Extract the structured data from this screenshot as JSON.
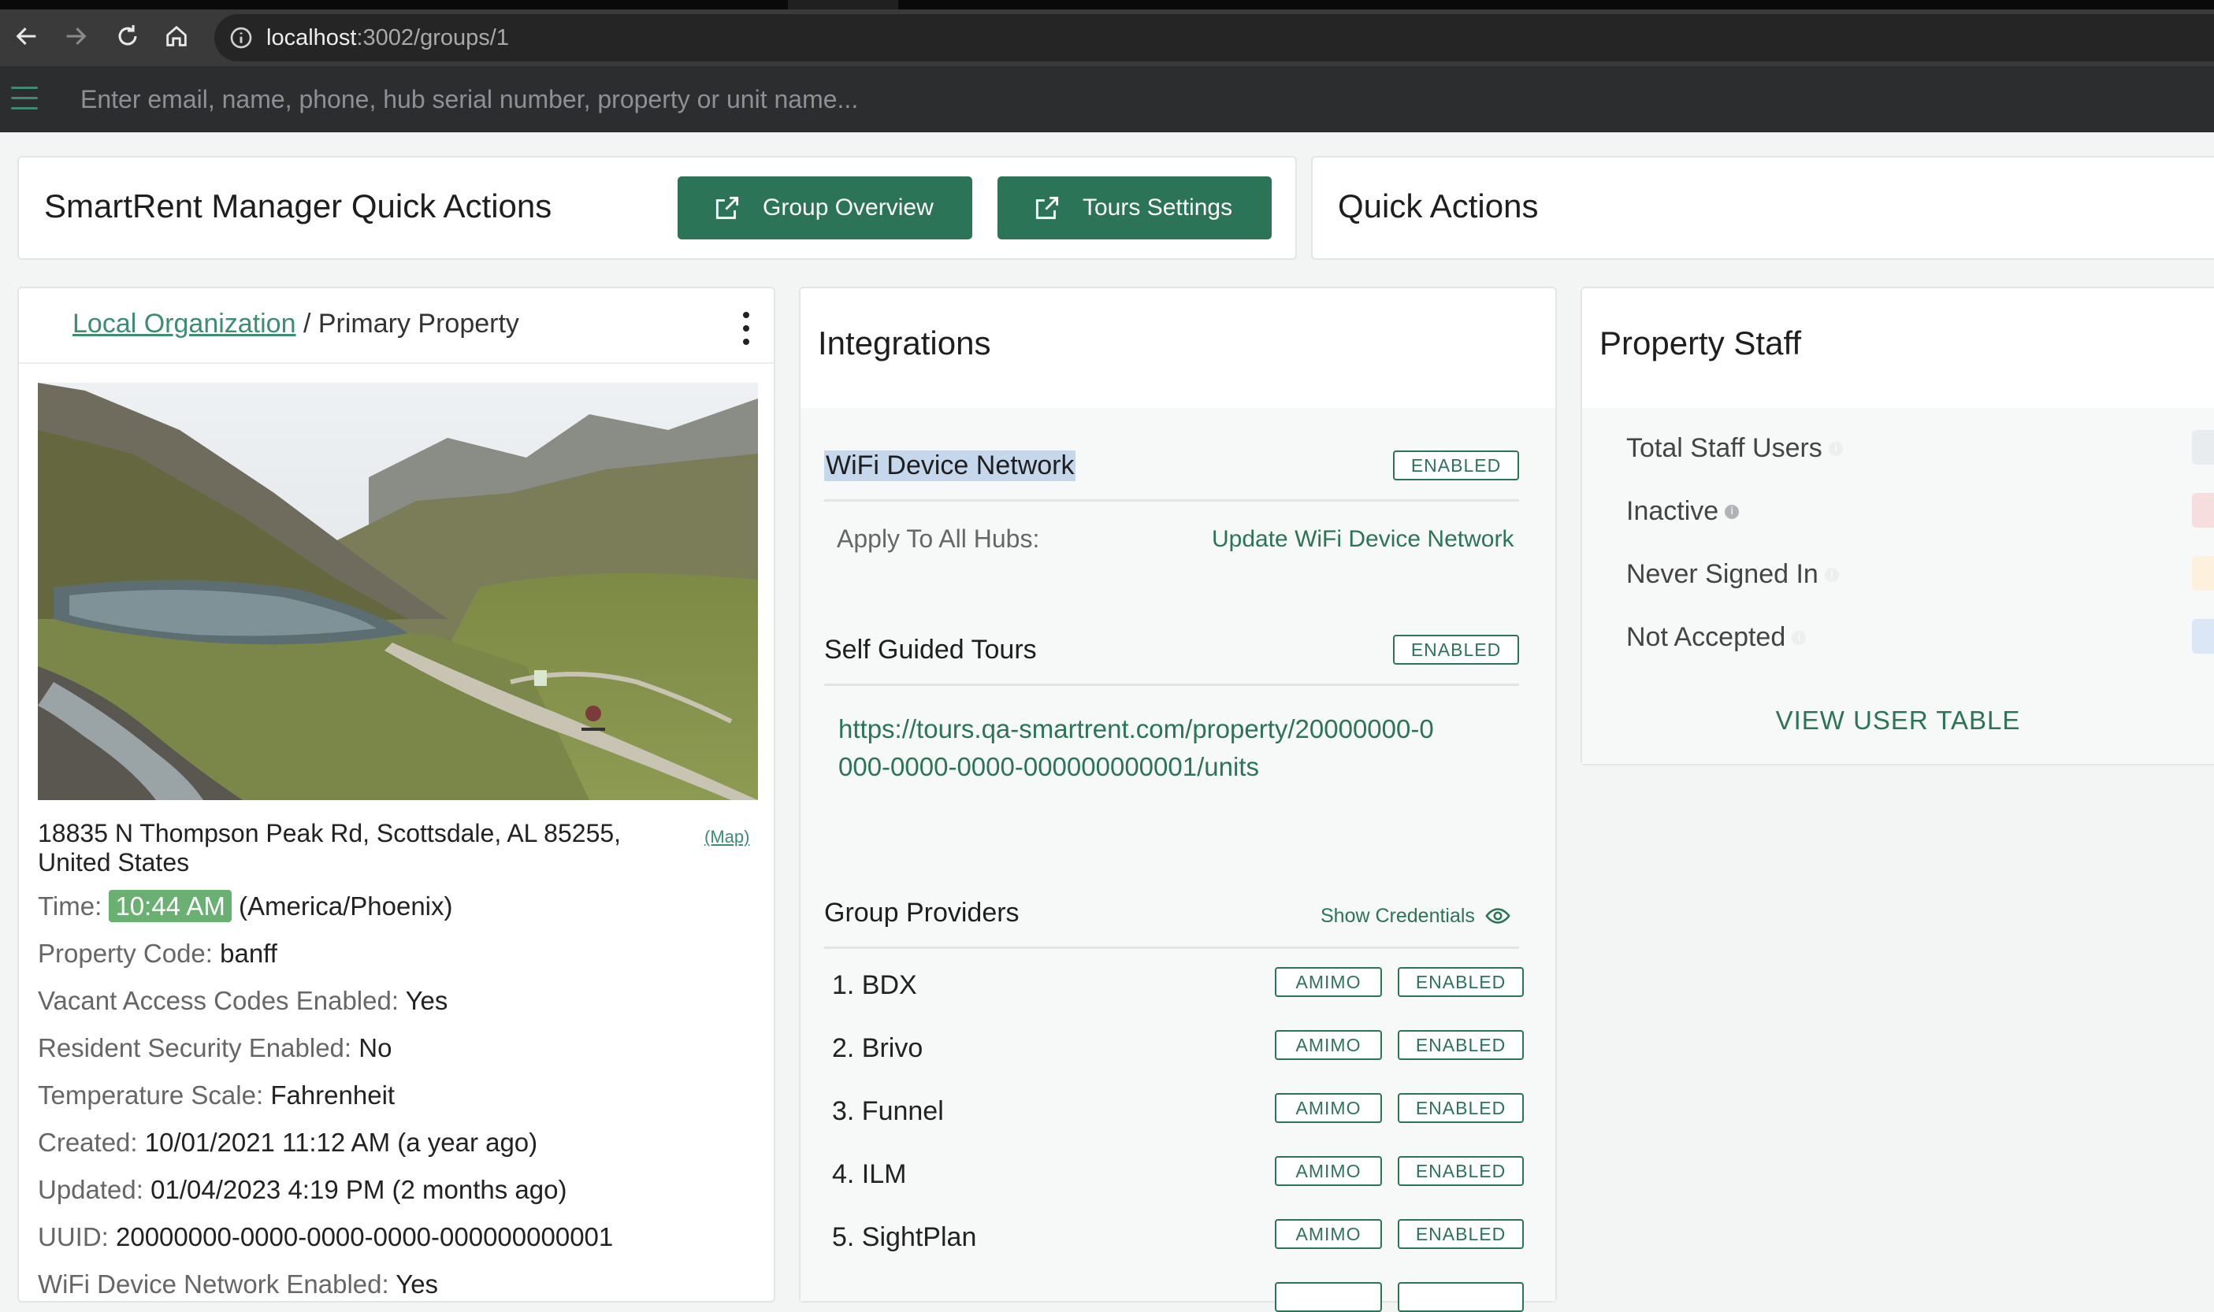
{
  "browser": {
    "url_host": "localhost",
    "url_path": ":3002/groups/1"
  },
  "appbar": {
    "search_placeholder": "Enter email, name, phone, hub serial number, property or unit name..."
  },
  "quick_actions_card": {
    "title": "SmartRent Manager Quick Actions",
    "group_overview_label": "Group Overview",
    "tours_settings_label": "Tours Settings"
  },
  "quick_actions_right": {
    "title": "Quick Actions"
  },
  "property": {
    "org_link": "Local Organization",
    "separator": " / ",
    "property_name": "Primary Property",
    "address": "18835 N Thompson Peak Rd, Scottsdale, AL 85255, United States",
    "map_link": "(Map)",
    "details": [
      {
        "key": "Time: ",
        "value": "10:44 AM",
        "extra": " (America/Phoenix)"
      },
      {
        "key": "Property Code: ",
        "value": "banff"
      },
      {
        "key": "Vacant Access Codes Enabled: ",
        "value": "Yes"
      },
      {
        "key": "Resident Security Enabled: ",
        "value": "No"
      },
      {
        "key": "Temperature Scale: ",
        "value": "Fahrenheit"
      },
      {
        "key": "Created: ",
        "value": "10/01/2021 11:12 AM (a year ago)"
      },
      {
        "key": "Updated: ",
        "value": "01/04/2023 4:19 PM (2 months ago)"
      },
      {
        "key": "UUID: ",
        "value": "20000000-0000-0000-0000-000000000001"
      },
      {
        "key": "WiFi Device Network Enabled: ",
        "value": "Yes"
      }
    ]
  },
  "integrations": {
    "title": "Integrations",
    "wifi": {
      "title": "WiFi Device Network",
      "status": "ENABLED",
      "apply_label": "Apply To All Hubs:",
      "update_link": "Update WiFi Device Network"
    },
    "tours": {
      "title": "Self Guided Tours",
      "status": "ENABLED",
      "link": "https://tours.qa-smartrent.com/property/20000000-0000-0000-0000-000000000001/units"
    },
    "providers": {
      "title": "Group Providers",
      "show_credentials": "Show Credentials",
      "items": [
        {
          "name": "1. BDX",
          "tag": "AMIMO",
          "status": "ENABLED"
        },
        {
          "name": "2. Brivo",
          "tag": "AMIMO",
          "status": "ENABLED"
        },
        {
          "name": "3. Funnel",
          "tag": "AMIMO",
          "status": "ENABLED"
        },
        {
          "name": "4. ILM",
          "tag": "AMIMO",
          "status": "ENABLED"
        },
        {
          "name": "5. SightPlan",
          "tag": "AMIMO",
          "status": "ENABLED"
        }
      ]
    }
  },
  "staff": {
    "title": "Property Staff",
    "rows": [
      {
        "label": "Total Staff Users",
        "color": "#e9ecef"
      },
      {
        "label": "Inactive",
        "color": "#f7dede"
      },
      {
        "label": "Never Signed In",
        "color": "#fdf1de"
      },
      {
        "label": "Not Accepted",
        "color": "#dbe7f6"
      }
    ],
    "view_table": "VIEW USER TABLE"
  },
  "colors": {
    "brand_green": "#2b7458",
    "link_green": "#3d8d6f",
    "time_badge": "#6ab073"
  }
}
